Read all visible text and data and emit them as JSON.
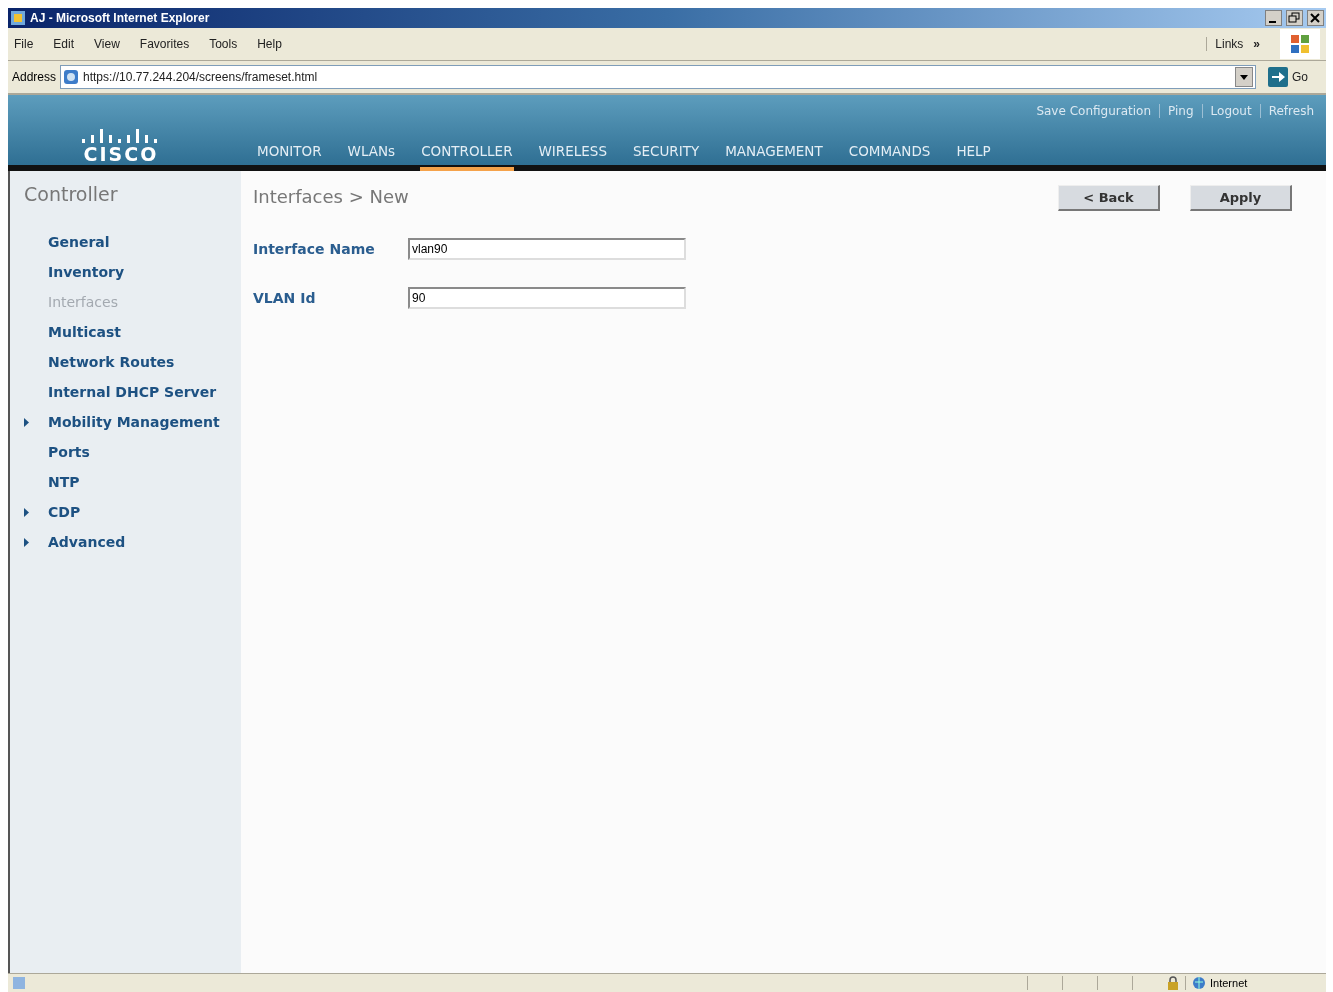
{
  "window": {
    "title": "AJ - Microsoft Internet Explorer"
  },
  "menu": [
    "File",
    "Edit",
    "View",
    "Favorites",
    "Tools",
    "Help"
  ],
  "links": {
    "label": "Links",
    "chevron": "»"
  },
  "address": {
    "label": "Address",
    "url": "https://10.77.244.204/screens/frameset.html",
    "go": "Go"
  },
  "header": {
    "logo": "CISCO",
    "top_links": [
      "Save Configuration",
      "Ping",
      "Logout",
      "Refresh"
    ],
    "nav": [
      {
        "label": "MONITOR",
        "selected": false
      },
      {
        "label": "WLANs",
        "selected": false
      },
      {
        "label": "CONTROLLER",
        "selected": true
      },
      {
        "label": "WIRELESS",
        "selected": false
      },
      {
        "label": "SECURITY",
        "selected": false
      },
      {
        "label": "MANAGEMENT",
        "selected": false
      },
      {
        "label": "COMMANDS",
        "selected": false
      },
      {
        "label": "HELP",
        "selected": false
      }
    ]
  },
  "sidebar": {
    "title": "Controller",
    "items": [
      {
        "label": "General",
        "selected": false,
        "expandable": false
      },
      {
        "label": "Inventory",
        "selected": false,
        "expandable": false
      },
      {
        "label": "Interfaces",
        "selected": true,
        "expandable": false
      },
      {
        "label": "Multicast",
        "selected": false,
        "expandable": false
      },
      {
        "label": "Network Routes",
        "selected": false,
        "expandable": false
      },
      {
        "label": "Internal DHCP Server",
        "selected": false,
        "expandable": false
      },
      {
        "label": "Mobility Management",
        "selected": false,
        "expandable": true
      },
      {
        "label": "Ports",
        "selected": false,
        "expandable": false
      },
      {
        "label": "NTP",
        "selected": false,
        "expandable": false
      },
      {
        "label": "CDP",
        "selected": false,
        "expandable": true
      },
      {
        "label": "Advanced",
        "selected": false,
        "expandable": true
      }
    ]
  },
  "page": {
    "breadcrumb": "Interfaces > New",
    "buttons": [
      "< Back",
      "Apply"
    ],
    "fields": [
      {
        "label": "Interface Name",
        "value": "vlan90"
      },
      {
        "label": "VLAN Id",
        "value": "90"
      }
    ]
  },
  "status_bar": {
    "zone": "Internet"
  }
}
